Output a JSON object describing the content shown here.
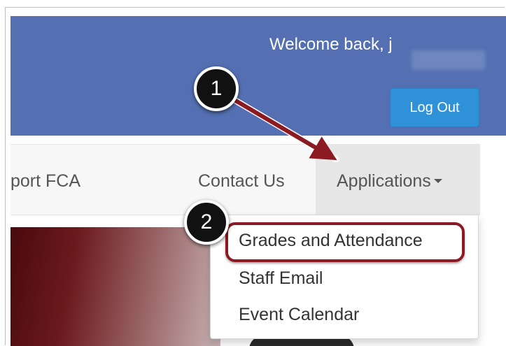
{
  "header": {
    "welcome_text": "Welcome back, j",
    "logout_label": "Log Out",
    "colors": {
      "background": "#5470b2",
      "button": "#2f91d8"
    }
  },
  "navbar": {
    "items": [
      {
        "label": "port FCA"
      },
      {
        "label": "Contact Us"
      },
      {
        "label": "Applications"
      }
    ]
  },
  "dropdown": {
    "items": [
      {
        "label": "Grades and Attendance"
      },
      {
        "label": "Staff Email"
      },
      {
        "label": "Event Calendar"
      }
    ],
    "highlight_color": "#8b1a22"
  },
  "annotations": {
    "step1": "1",
    "step2": "2",
    "arrow_color": "#8b1a22"
  }
}
